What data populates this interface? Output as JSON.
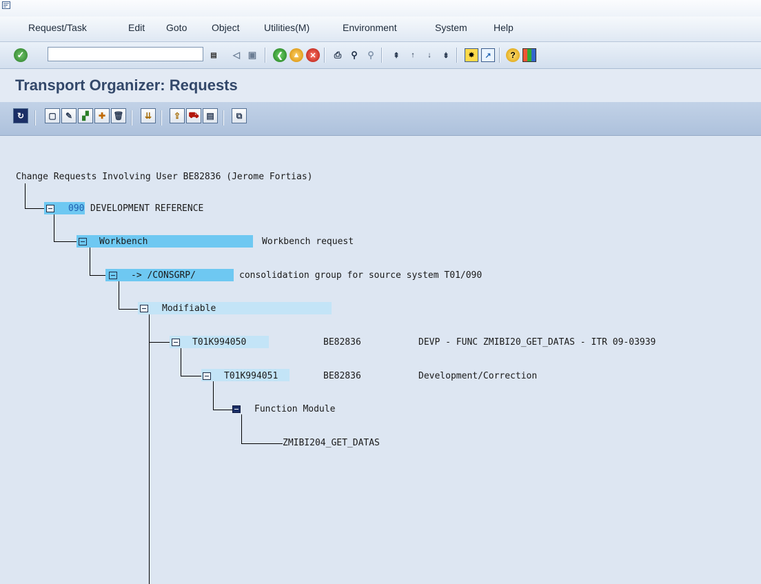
{
  "menu": [
    {
      "label": "Request/Task",
      "name": "menu-request-task"
    },
    {
      "label": "Edit",
      "name": "menu-edit"
    },
    {
      "label": "Goto",
      "name": "menu-goto"
    },
    {
      "label": "Object",
      "name": "menu-object"
    },
    {
      "label": "Utilities(M)",
      "name": "menu-utilities"
    },
    {
      "label": "Environment",
      "name": "menu-environment"
    },
    {
      "label": "System",
      "name": "menu-system"
    },
    {
      "label": "Help",
      "name": "menu-help"
    }
  ],
  "toolbar": {
    "command_field": "",
    "icons": [
      "enter-icon",
      "command-dropdown-icon",
      "back-arrow-icon",
      "save-icon",
      "back-icon",
      "exit-icon",
      "cancel-icon",
      "print-icon",
      "find-icon",
      "find-next-icon",
      "first-page-icon",
      "previous-page-icon",
      "next-page-icon",
      "last-page-icon",
      "create-session-icon",
      "shortcut-icon",
      "help-icon",
      "customize-layout-icon"
    ]
  },
  "screen_title": "Transport Organizer: Requests",
  "app_toolbar_icons": [
    "refresh-icon",
    "create-icon",
    "change-display-icon",
    "change-owner-icon",
    "add-user-icon",
    "delete-icon",
    "sort-compress-icon",
    "release-icon",
    "release-directly-icon",
    "check-objects-icon",
    "copy-icon"
  ],
  "tree": {
    "header": "Change Requests Involving User BE82836 (Jerome Fortias)",
    "client": {
      "code": "090",
      "desc": "DEVELOPMENT REFERENCE"
    },
    "workbench": {
      "label": "Workbench",
      "desc": "Workbench request"
    },
    "target": {
      "label": "-> /CONSGRP/",
      "desc": "consolidation group for source system T01/090"
    },
    "status": {
      "label": "Modifiable"
    },
    "request": {
      "id": "T01K994050",
      "owner": "BE82836",
      "desc": "DEVP - FUNC ZMIBI20_GET_DATAS - ITR 09-03939"
    },
    "task": {
      "id": "T01K994051",
      "owner": "BE82836",
      "desc": "Development/Correction"
    },
    "object_type": {
      "label": "Function Module"
    },
    "object": {
      "label": "ZMIBI204_GET_DATAS"
    }
  },
  "colors": {
    "selection": "#6ec8f2",
    "light_selection": "#c3e4f7",
    "title_text": "#33486a"
  }
}
